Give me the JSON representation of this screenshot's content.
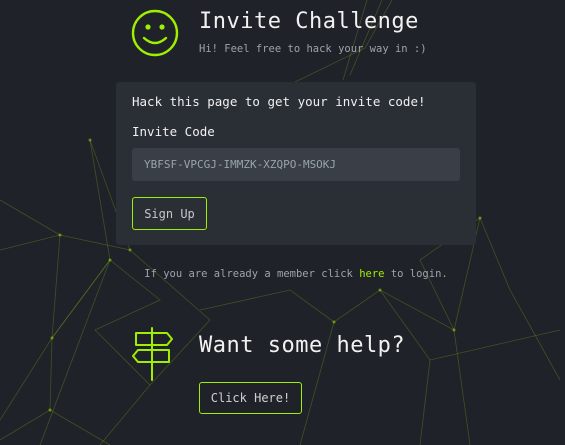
{
  "header": {
    "title": "Invite Challenge",
    "subtitle": "Hi! Feel free to hack your way in :)"
  },
  "card": {
    "heading": "Hack this page to get your invite code!",
    "field_label": "Invite Code",
    "invite_code_value": "YBFSF-VPCGJ-IMMZK-XZQPO-MSOKJ",
    "signup_label": "Sign Up"
  },
  "login": {
    "prefix": "If you are already a member click ",
    "link_text": "here",
    "suffix": " to login."
  },
  "help": {
    "title": "Want some help?",
    "button_label": "Click Here!"
  },
  "icons": {
    "header_icon": "smiley-face-icon",
    "help_icon": "signpost-icon"
  },
  "colors": {
    "background": "#1f2228",
    "card": "#2a2e35",
    "input": "#3a3f47",
    "accent": "#9fef00",
    "muted_text": "#9ea4ab"
  }
}
